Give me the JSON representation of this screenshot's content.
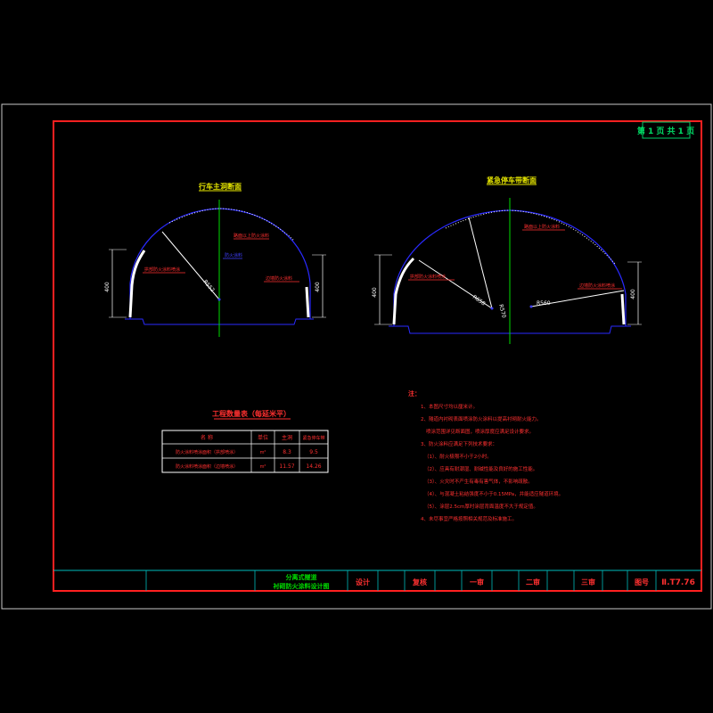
{
  "sheet": {
    "page_label": "第 1 页  共 1 页",
    "drawing_number_label": "图号",
    "drawing_number": "Ⅱ.T7.76"
  },
  "section_left": {
    "title": "行车主洞断面",
    "dim_left": "400",
    "dim_right": "400",
    "radius_label": "R552",
    "callout_top": "路面以上防火涂料",
    "callout_center": "防火涂料",
    "callout_left": "拱部防火涂料喷涂",
    "callout_right": "边墙防火涂料"
  },
  "section_right": {
    "title": "紧急停车带断面",
    "dim_left": "400",
    "dim_right": "400",
    "radius1_label": "R658",
    "radius2_label": "R570",
    "radius3_label": "R560",
    "callout_top": "路面以上防火涂料",
    "callout_left": "拱部防火涂料喷涂",
    "callout_right": "边墙防火涂料喷涂"
  },
  "quantity_table": {
    "title": "工程数量表（每延米平）",
    "headers": [
      "名 称",
      "单位",
      "主洞",
      "紧急停车带"
    ],
    "rows": [
      [
        "防火涂料喷涂面积（拱部喷涂）",
        "m²",
        "8.3",
        "9.5"
      ],
      [
        "防火涂料喷涂面积（边墙喷涂）",
        "m²",
        "11.57",
        "14.26"
      ]
    ]
  },
  "notes": {
    "heading": "注：",
    "lines": [
      "1、本图尺寸均以厘米计。",
      "2、隧道内衬砌表面喷涂防火涂料以提高衬砌耐火能力。",
      "   喷涂范围详见断面图，喷涂厚度应满足设计要求。",
      "3、防火涂料应满足下列技术要求：",
      "  （1）、耐火极限不小于2小时。",
      "  （2）、应具有耐潮湿、耐碱性能及良好的施工性能。",
      "  （3）、火灾时不产生有毒有害气体，不影响疏散。",
      "  （4）、与混凝土粘结强度不小于0.15MPa，并能适应隧道环境。",
      "  （5）、涂层2.5cm厚时涂层背面温度不大于规定值。",
      "4、未尽事宜严格按照相关规范及标准施工。"
    ]
  },
  "title_block": {
    "project_line1": "分离式隧道",
    "project_line2": "衬砌防火涂料设计图",
    "design": "设计",
    "review": "复核",
    "check1": "一审",
    "check2": "二审",
    "check3": "三审"
  },
  "colors": {
    "frame": "#ff2020",
    "outer_frame": "#c8c8c8",
    "lining": "#2a2aff",
    "centerline": "#00dd00",
    "text_yellow": "#e6e600",
    "text_red": "#ff3030",
    "text_blue": "#4040ff",
    "coating": "#ffffff"
  }
}
